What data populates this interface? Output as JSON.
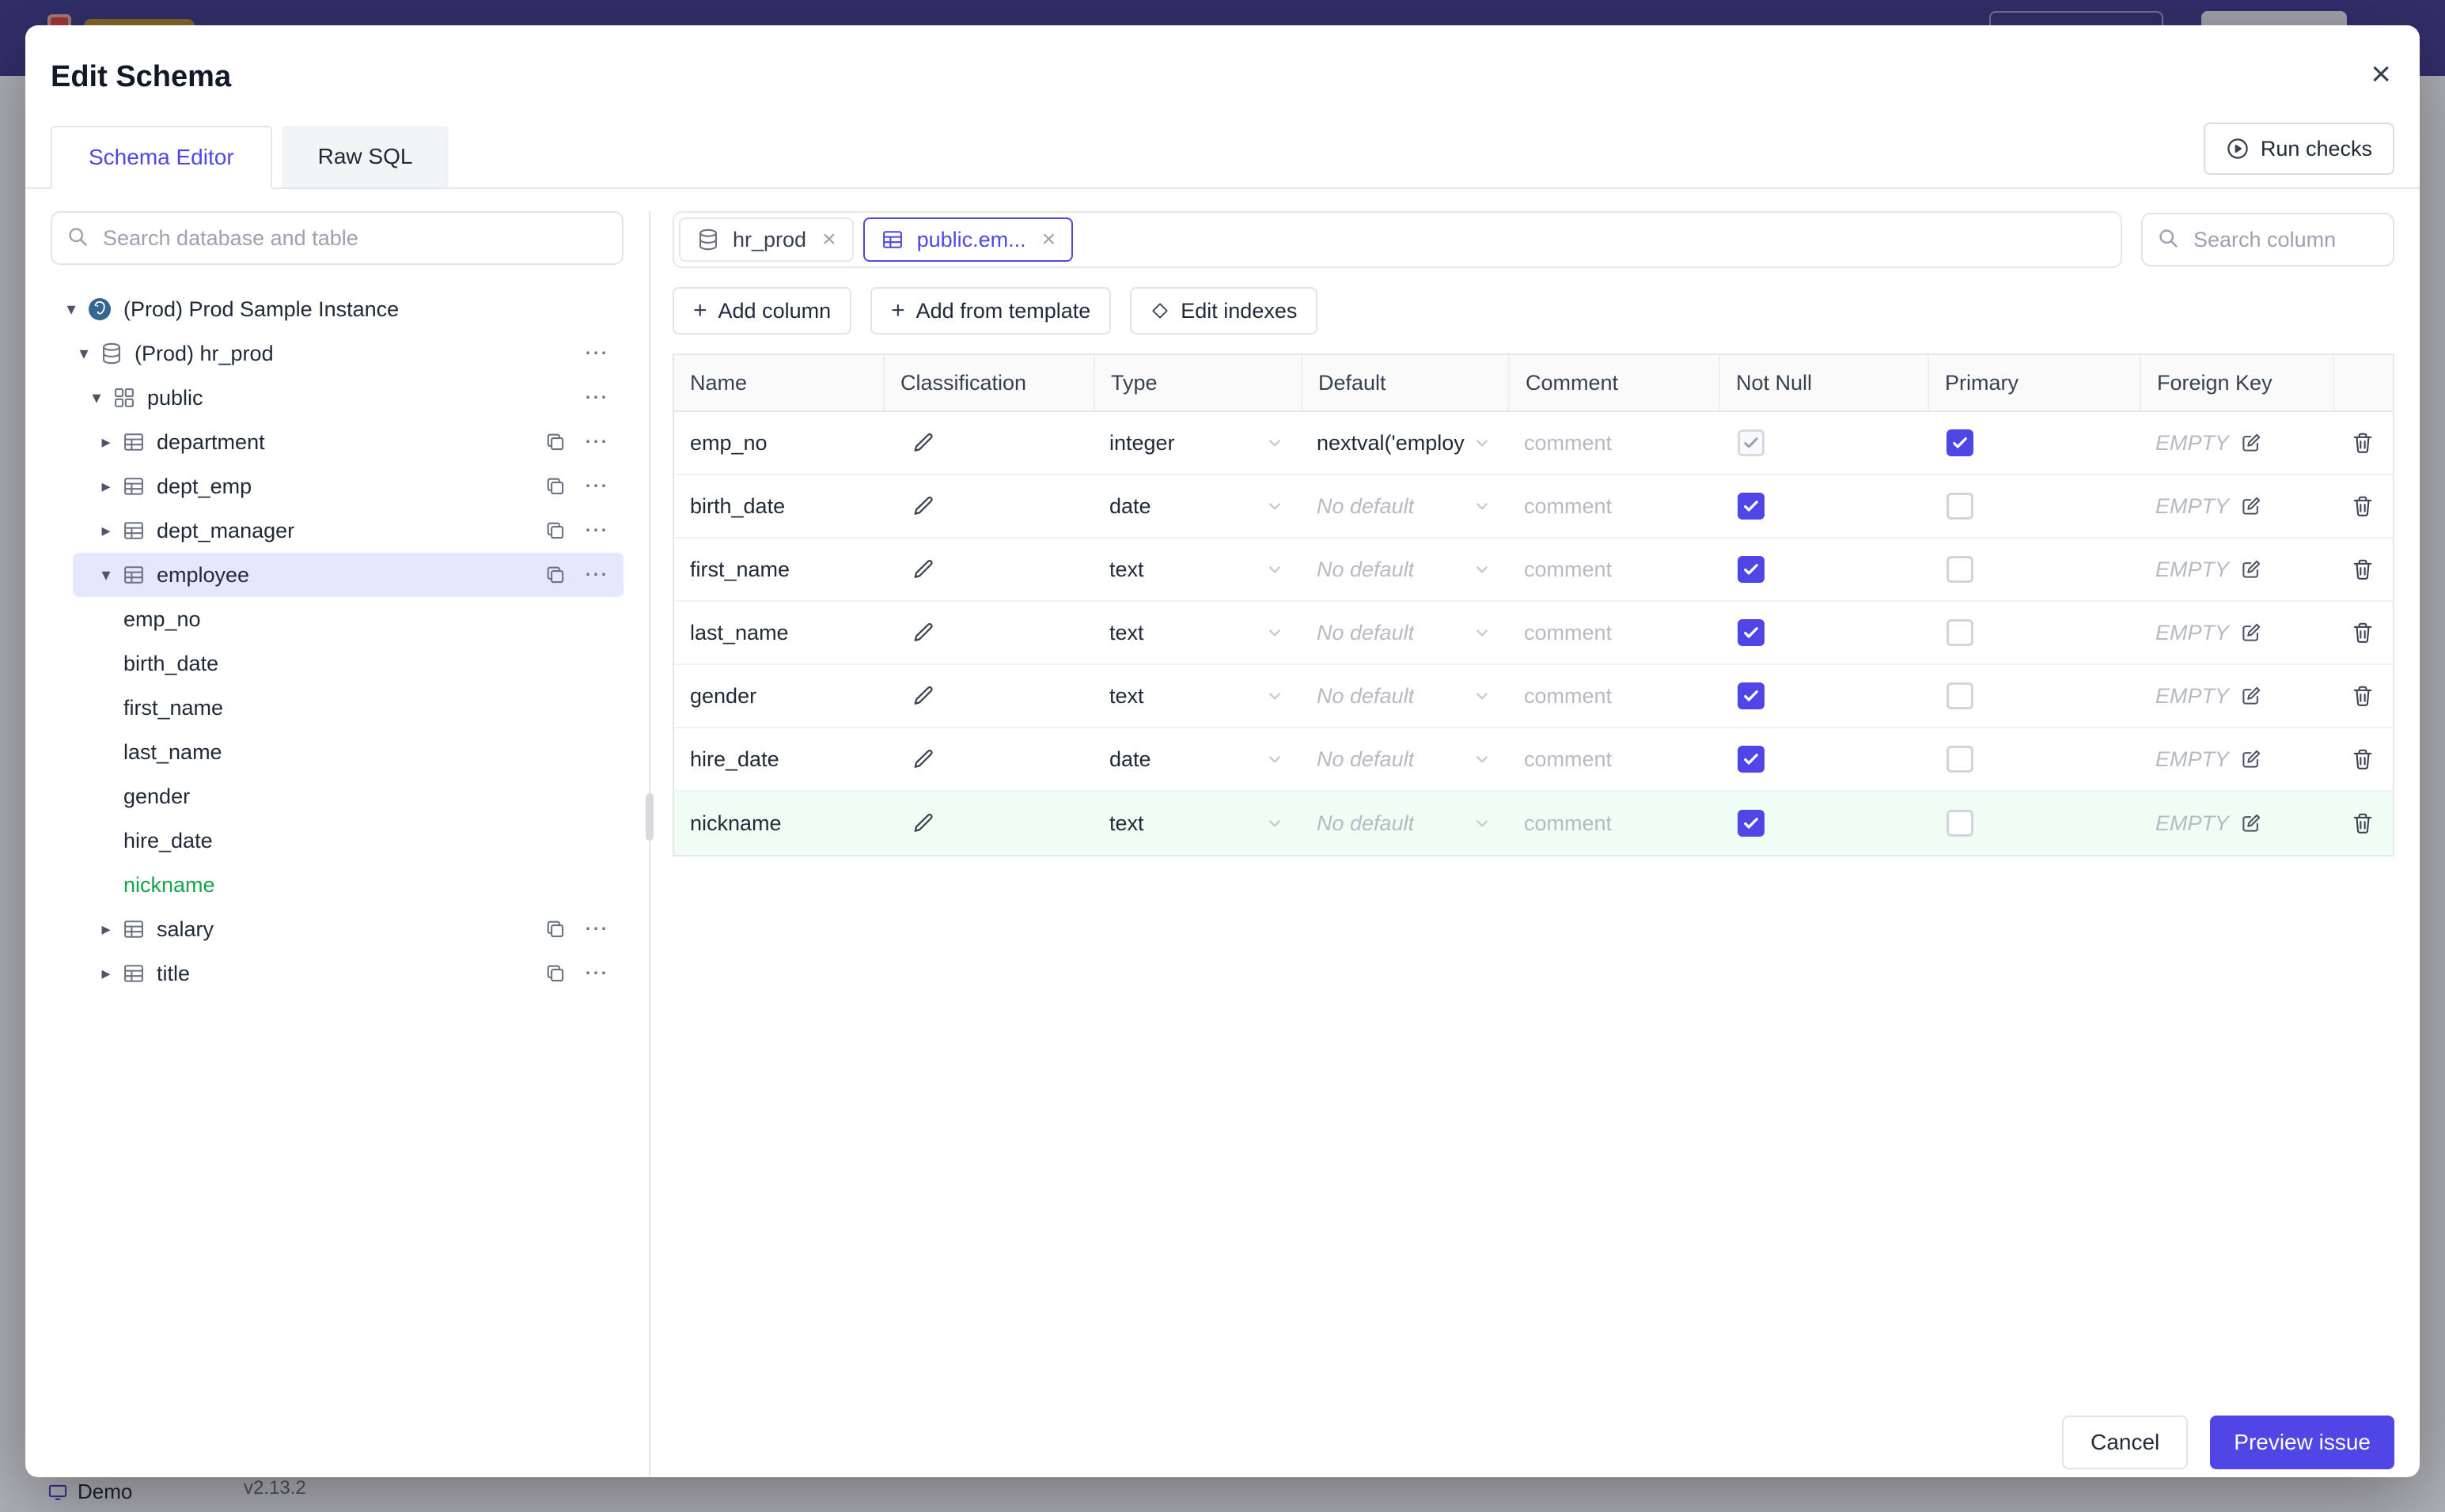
{
  "page_behind": {
    "demo_label": "Demo",
    "version": "v2.13.2"
  },
  "icons": {
    "caret_expanded": "▾",
    "caret_collapsed": "▸",
    "more": "⋯",
    "close": "×",
    "plus": "+"
  },
  "modal": {
    "title": "Edit Schema",
    "tabs": [
      {
        "label": "Schema Editor",
        "active": true
      },
      {
        "label": "Raw SQL",
        "active": false
      }
    ],
    "run_checks_label": "Run checks",
    "footer": {
      "cancel_label": "Cancel",
      "preview_label": "Preview issue"
    }
  },
  "sidebar": {
    "search_placeholder": "Search database and table",
    "tree": [
      {
        "type": "instance",
        "label": "(Prod) Prod Sample Instance",
        "icon": "postgres",
        "expanded": true
      },
      {
        "type": "database",
        "label": "(Prod) hr_prod",
        "icon": "database",
        "expanded": true,
        "actions": [
          "more"
        ]
      },
      {
        "type": "schema",
        "label": "public",
        "icon": "schema",
        "expanded": true,
        "actions": [
          "more"
        ]
      },
      {
        "type": "table",
        "label": "department",
        "icon": "table",
        "expanded": false,
        "actions": [
          "copy",
          "more"
        ]
      },
      {
        "type": "table",
        "label": "dept_emp",
        "icon": "table",
        "expanded": false,
        "actions": [
          "copy",
          "more"
        ]
      },
      {
        "type": "table",
        "label": "dept_manager",
        "icon": "table",
        "expanded": false,
        "actions": [
          "copy",
          "more"
        ]
      },
      {
        "type": "table",
        "label": "employee",
        "icon": "table",
        "expanded": true,
        "selected": true,
        "actions": [
          "copy",
          "more"
        ]
      },
      {
        "type": "column",
        "label": "emp_no"
      },
      {
        "type": "column",
        "label": "birth_date"
      },
      {
        "type": "column",
        "label": "first_name"
      },
      {
        "type": "column",
        "label": "last_name"
      },
      {
        "type": "column",
        "label": "gender"
      },
      {
        "type": "column",
        "label": "hire_date"
      },
      {
        "type": "column",
        "label": "nickname",
        "new": true
      },
      {
        "type": "table",
        "label": "salary",
        "icon": "table",
        "expanded": false,
        "actions": [
          "copy",
          "more"
        ]
      },
      {
        "type": "table",
        "label": "title",
        "icon": "table",
        "expanded": false,
        "actions": [
          "copy",
          "more"
        ]
      }
    ]
  },
  "editor": {
    "chips": [
      {
        "label": "hr_prod",
        "icon": "database",
        "active": false
      },
      {
        "label": "public.em...",
        "icon": "table",
        "active": true
      }
    ],
    "column_search_placeholder": "Search column",
    "toolbar": [
      {
        "label": "Add column",
        "icon": "plus"
      },
      {
        "label": "Add from template",
        "icon": "plus"
      },
      {
        "label": "Edit indexes",
        "icon": "diamond"
      }
    ],
    "table": {
      "headers": [
        "Name",
        "Classification",
        "Type",
        "Default",
        "Comment",
        "Not Null",
        "Primary",
        "Foreign Key",
        ""
      ],
      "comment_placeholder": "comment",
      "fk_placeholder": "EMPTY",
      "rows": [
        {
          "name": "emp_no",
          "type": "integer",
          "default": "nextval('employ",
          "default_is_placeholder": false,
          "not_null": true,
          "not_null_disabled": true,
          "primary": true,
          "new": false
        },
        {
          "name": "birth_date",
          "type": "date",
          "default": "No default",
          "default_is_placeholder": true,
          "not_null": true,
          "not_null_disabled": false,
          "primary": false,
          "new": false
        },
        {
          "name": "first_name",
          "type": "text",
          "default": "No default",
          "default_is_placeholder": true,
          "not_null": true,
          "not_null_disabled": false,
          "primary": false,
          "new": false
        },
        {
          "name": "last_name",
          "type": "text",
          "default": "No default",
          "default_is_placeholder": true,
          "not_null": true,
          "not_null_disabled": false,
          "primary": false,
          "new": false
        },
        {
          "name": "gender",
          "type": "text",
          "default": "No default",
          "default_is_placeholder": true,
          "not_null": true,
          "not_null_disabled": false,
          "primary": false,
          "new": false
        },
        {
          "name": "hire_date",
          "type": "date",
          "default": "No default",
          "default_is_placeholder": true,
          "not_null": true,
          "not_null_disabled": false,
          "primary": false,
          "new": false
        },
        {
          "name": "nickname",
          "type": "text",
          "default": "No default",
          "default_is_placeholder": true,
          "not_null": true,
          "not_null_disabled": false,
          "primary": false,
          "new": true
        }
      ]
    }
  },
  "colors": {
    "accent": "#4f46e5",
    "new_green": "#16a34a",
    "new_row_bg": "#f0fdf4",
    "selected_tree_bg": "#e3e8fd",
    "topbar": "#413e8a",
    "border": "#e5e7eb",
    "muted_text": "#b6bac3"
  }
}
